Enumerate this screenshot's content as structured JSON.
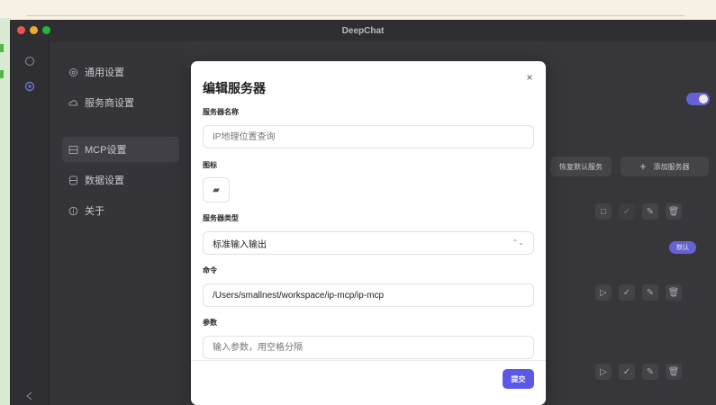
{
  "window": {
    "title": "DeepChat"
  },
  "colors": {
    "accent": "#5b57e8",
    "toggle": "#6f6be8",
    "close_dot": "#ff5f57",
    "min_dot": "#febc2e",
    "max_dot": "#28c840"
  },
  "rail": {
    "icons": [
      "chat-bubble-icon",
      "gear-icon",
      "back-icon"
    ]
  },
  "nav": {
    "items": [
      {
        "label": "通用设置",
        "icon": "gear-icon"
      },
      {
        "label": "服务商设置",
        "icon": "cloud-icon"
      },
      {
        "label": "MCP设置",
        "icon": "server-icon"
      },
      {
        "label": "数据设置",
        "icon": "database-icon"
      },
      {
        "label": "关于",
        "icon": "info-icon"
      }
    ]
  },
  "content": {
    "restore_button": "恢复默认服务",
    "add_button": "添加服务器",
    "add_icon": "+",
    "default_badge": "默认"
  },
  "modal": {
    "title": "编辑服务器",
    "close_icon": "×",
    "name_label": "服务器名称",
    "name_placeholder": "IP地理位置查询",
    "icon_label": "图标",
    "icon_value": "▰",
    "type_label": "服务器类型",
    "type_value": "标准输入输出",
    "command_label": "命令",
    "command_value": "/Users/smallnest/workspace/ip-mcp/ip-mcp",
    "args_label": "参数",
    "args_placeholder": "输入参数，用空格分隔",
    "submit_label": "提交"
  }
}
